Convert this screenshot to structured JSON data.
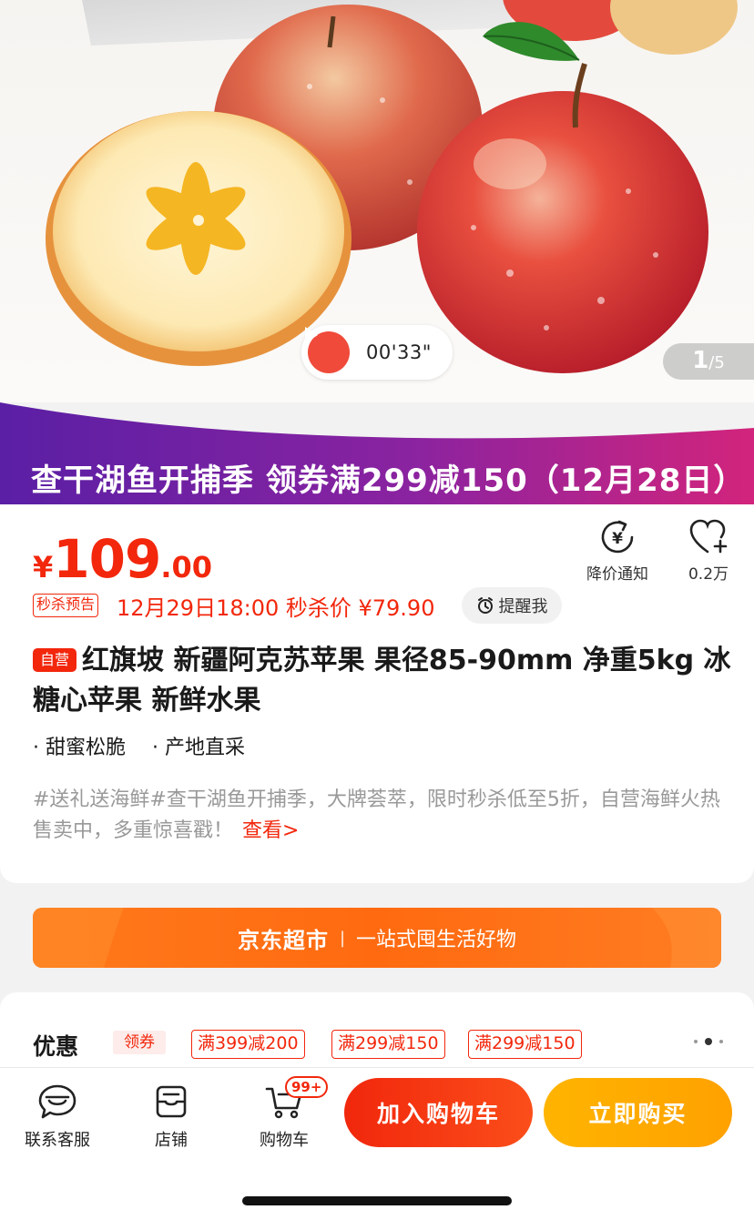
{
  "gallery": {
    "video_duration": "00'33\"",
    "page_current": "1",
    "page_total": "/5"
  },
  "promo_banner": {
    "text": "查干湖鱼开捕季  领券满299减150（12月28日）",
    "colors": {
      "start": "#5a1fa5",
      "end": "#d2247c"
    }
  },
  "price": {
    "currency": "¥",
    "integer": "109",
    "decimal": ".00",
    "color": "#f2270c"
  },
  "actions": {
    "price_alert_label": "降价通知",
    "favorite_count": "0.2万"
  },
  "flash_sale": {
    "tag": "秒杀预告",
    "text": "12月29日18:00 秒杀价 ¥79.90",
    "remind_label": "提醒我"
  },
  "product": {
    "self_operated_tag": "自营",
    "title": "红旗坡 新疆阿克苏苹果 果径85-90mm 净重5kg 冰糖心苹果 新鲜水果",
    "features": [
      "· 甜蜜松脆",
      "· 产地直采"
    ],
    "description": "#送礼送海鲜#查干湖鱼开捕季，大牌荟萃，限时秒杀低至5折，自营海鲜火热售卖中，多重惊喜戳！",
    "more_link": "查看>"
  },
  "jd_supermarket": {
    "brand": "京东超市",
    "separator": "|",
    "slogan": "一站式囤生活好物"
  },
  "coupons": {
    "title": "优惠",
    "tag": "领券",
    "items": [
      "满399减200",
      "满299减150",
      "满299减150"
    ]
  },
  "bottom_bar": {
    "service_label": "联系客服",
    "shop_label": "店铺",
    "cart_label": "购物车",
    "cart_badge": "99+",
    "add_to_cart": "加入购物车",
    "buy_now": "立即购买"
  }
}
